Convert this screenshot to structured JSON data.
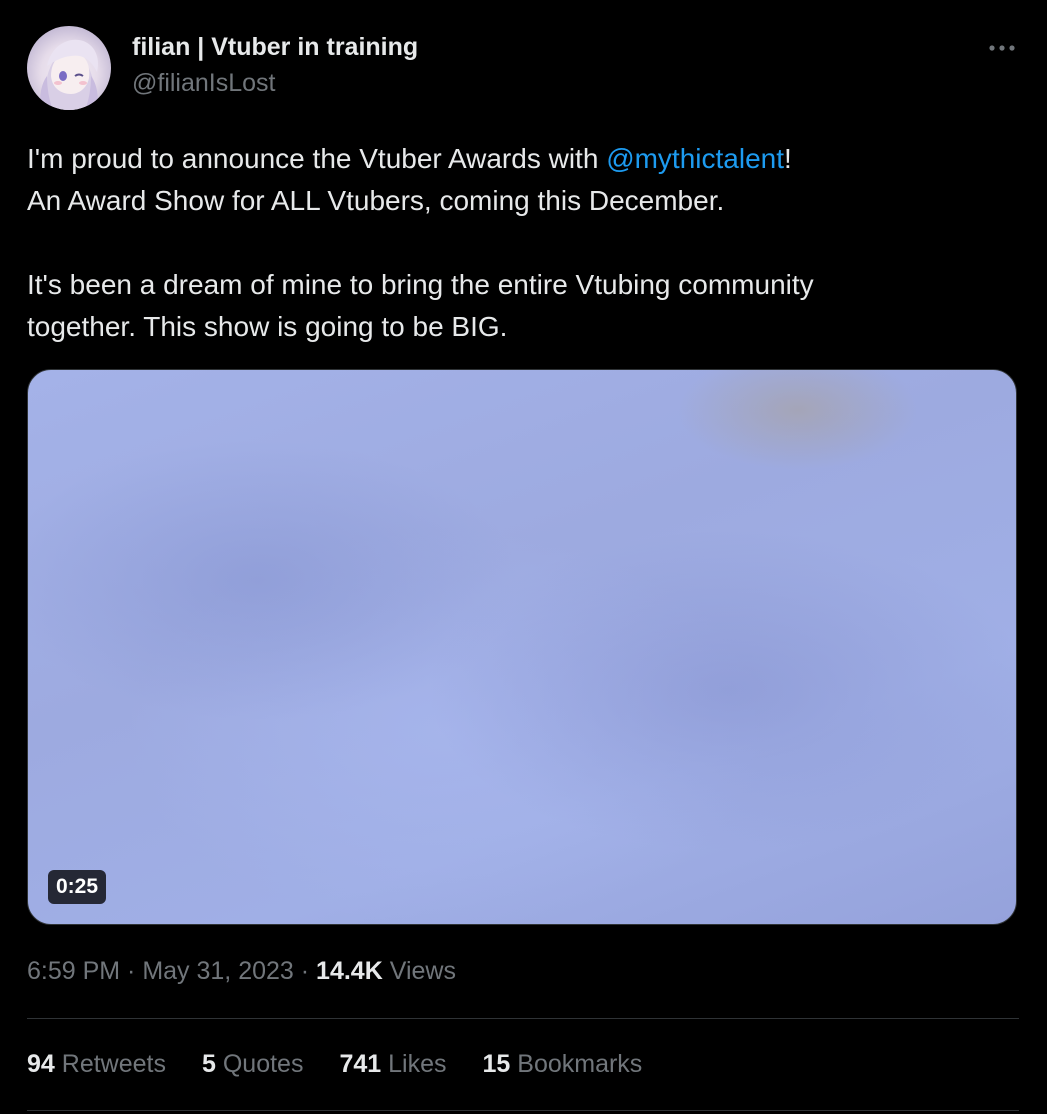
{
  "tweet": {
    "display_name": "filian | Vtuber in training",
    "handle": "@filianIsLost",
    "more_icon": "ellipsis-icon",
    "text_line1_before": "I'm proud to announce the Vtuber Awards with ",
    "mention": "@mythictalent",
    "text_line1_after": "!",
    "text_line2": "An Award Show for ALL Vtubers, coming this December.",
    "text_line3": "It's been a dream of mine to bring the entire Vtubing community",
    "text_line4": "together. This show is going to be BIG.",
    "video_duration": "0:25",
    "time": "6:59 PM",
    "date": "May 31, 2023",
    "views_count": "14.4K",
    "views_label": "Views",
    "stats": [
      {
        "count": "94",
        "label": "Retweets"
      },
      {
        "count": "5",
        "label": "Quotes"
      },
      {
        "count": "741",
        "label": "Likes"
      },
      {
        "count": "15",
        "label": "Bookmarks"
      }
    ]
  },
  "colors": {
    "background": "#000000",
    "text": "#e7e9ea",
    "secondary_text": "#71767b",
    "link": "#1d9bf0",
    "divider": "#2f3336"
  }
}
